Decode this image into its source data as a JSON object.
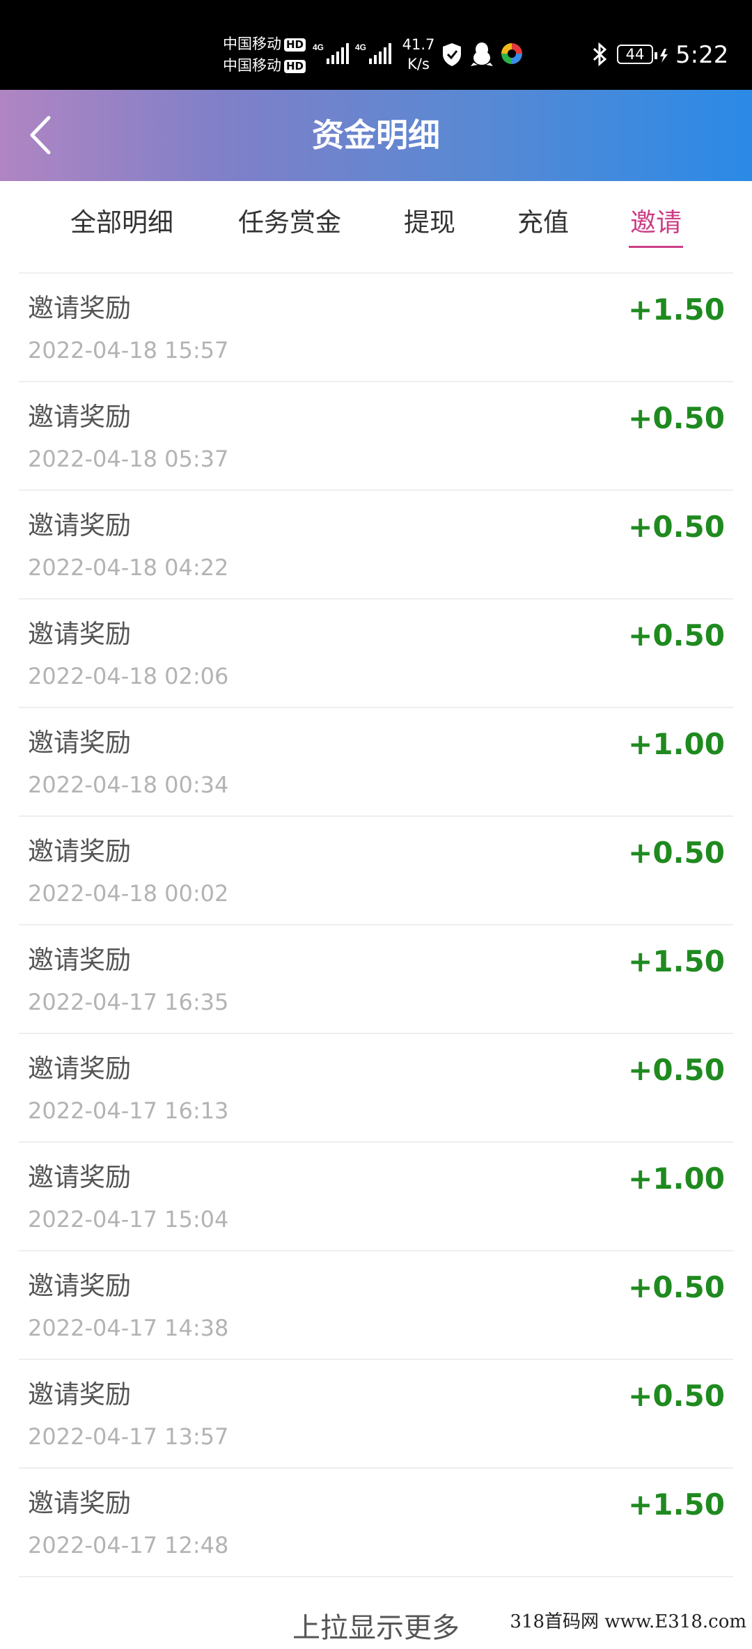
{
  "status_bar": {
    "carrier_1": "中国移动",
    "carrier_2": "中国移动",
    "hd_badge": "HD",
    "network_1": "4G",
    "network_2": "4G",
    "net_speed_value": "41.7",
    "net_speed_unit": "K/s",
    "battery_level": "44",
    "time": "5:22",
    "icons": [
      "signal-icon",
      "shield-icon",
      "penguin-icon",
      "app-icon",
      "bluetooth-icon",
      "battery-icon",
      "charging-icon"
    ]
  },
  "header": {
    "title": "资金明细",
    "back_icon": "chevron-left-icon",
    "gradient": [
      "#b085c2",
      "#2a8ae6"
    ]
  },
  "tabs": {
    "items": [
      {
        "label": "全部明细"
      },
      {
        "label": "任务赏金"
      },
      {
        "label": "提现"
      },
      {
        "label": "充值"
      },
      {
        "label": "邀请"
      }
    ],
    "selected": "邀请",
    "active_color": "#cc3e86"
  },
  "records": [
    {
      "title": "邀请奖励",
      "time": "2022-04-18 15:57",
      "amount": "+1.50"
    },
    {
      "title": "邀请奖励",
      "time": "2022-04-18 05:37",
      "amount": "+0.50"
    },
    {
      "title": "邀请奖励",
      "time": "2022-04-18 04:22",
      "amount": "+0.50"
    },
    {
      "title": "邀请奖励",
      "time": "2022-04-18 02:06",
      "amount": "+0.50"
    },
    {
      "title": "邀请奖励",
      "time": "2022-04-18 00:34",
      "amount": "+1.00"
    },
    {
      "title": "邀请奖励",
      "time": "2022-04-18 00:02",
      "amount": "+0.50"
    },
    {
      "title": "邀请奖励",
      "time": "2022-04-17 16:35",
      "amount": "+1.50"
    },
    {
      "title": "邀请奖励",
      "time": "2022-04-17 16:13",
      "amount": "+0.50"
    },
    {
      "title": "邀请奖励",
      "time": "2022-04-17 15:04",
      "amount": "+1.00"
    },
    {
      "title": "邀请奖励",
      "time": "2022-04-17 14:38",
      "amount": "+0.50"
    },
    {
      "title": "邀请奖励",
      "time": "2022-04-17 13:57",
      "amount": "+0.50"
    },
    {
      "title": "邀请奖励",
      "time": "2022-04-17 12:48",
      "amount": "+1.50"
    }
  ],
  "amount_color": "#1f8a1f",
  "footer": {
    "load_more": "上拉显示更多"
  },
  "watermark": "318首码网  www.E318.com"
}
